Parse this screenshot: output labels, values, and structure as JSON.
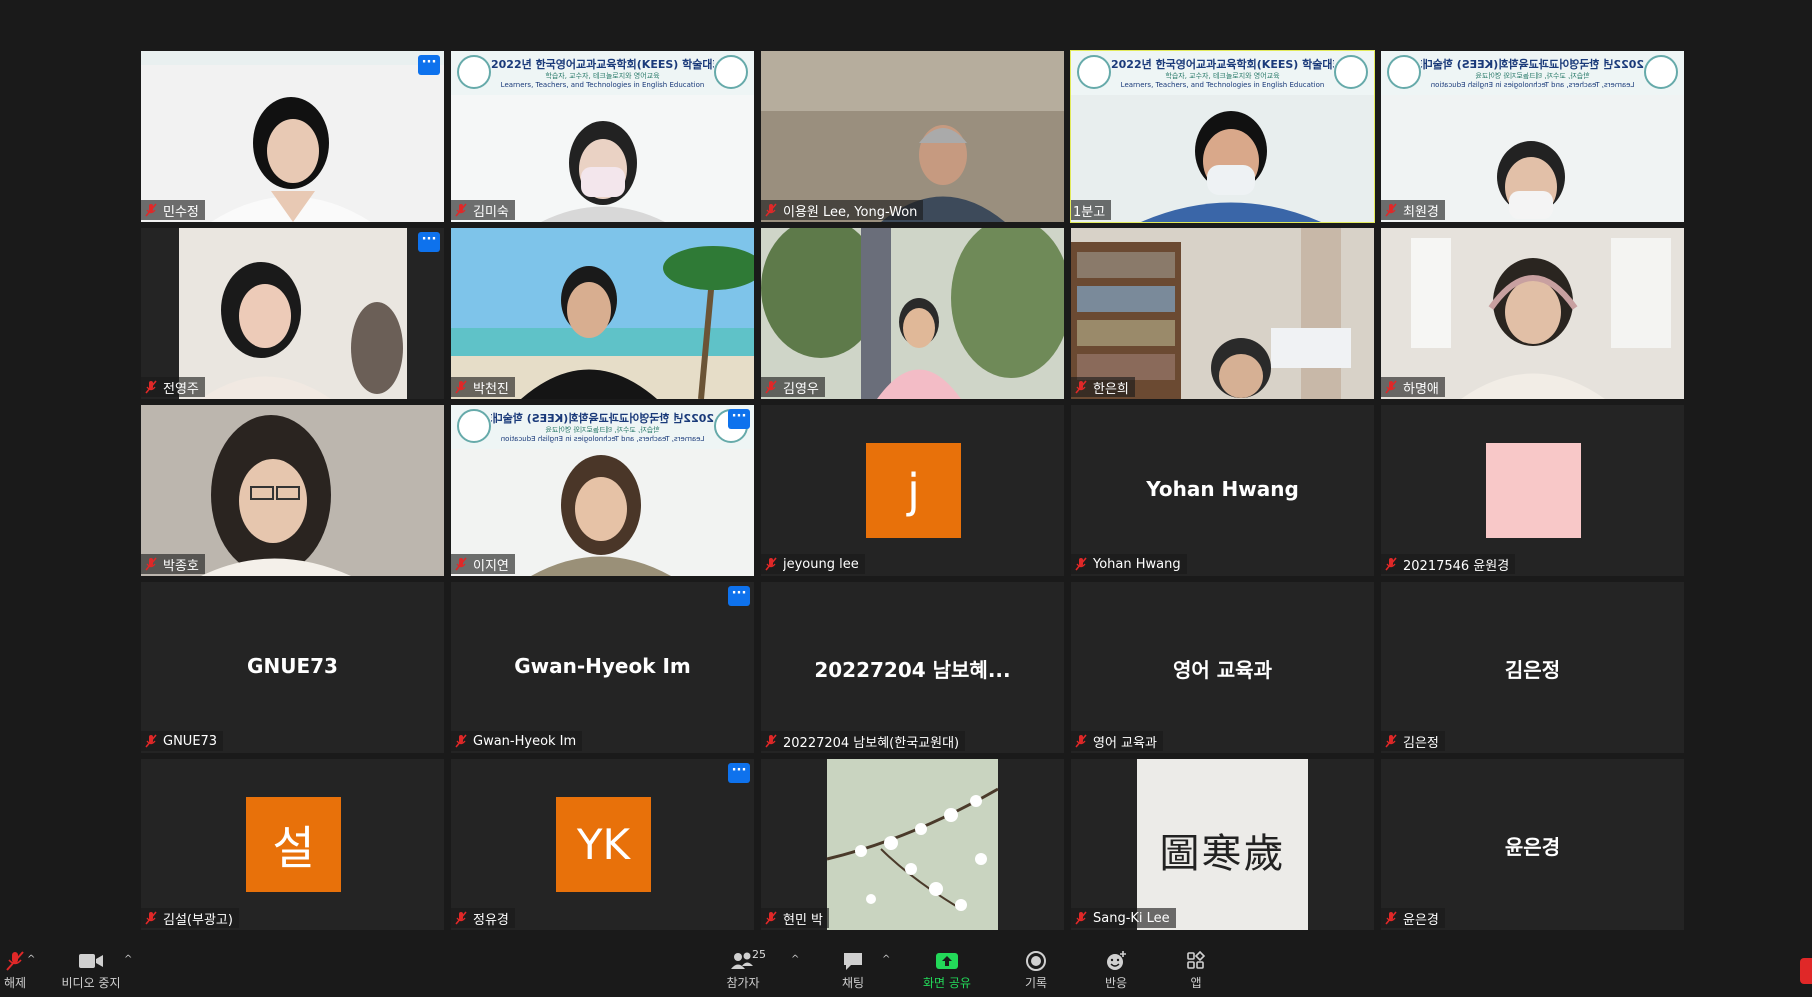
{
  "conference_banner": {
    "line1": "2022년 한국영어교과교육학회(KEES) 학술대회",
    "line2": "학습자, 교수자, 테크놀로지와 영어교육",
    "line3": "Learners, Teachers, and Technologies in English Education"
  },
  "participants": [
    {
      "name": "민수정"
    },
    {
      "name": "김미숙"
    },
    {
      "name": "이용원 Lee,  Yong-Won"
    },
    {
      "name": "1분고"
    },
    {
      "name": "최원경"
    },
    {
      "name": "전영주"
    },
    {
      "name": "박천진"
    },
    {
      "name": "김영우"
    },
    {
      "name": "한은희"
    },
    {
      "name": "하명애"
    },
    {
      "name": "박종호"
    },
    {
      "name": "이지연"
    },
    {
      "name": "jeyoung lee",
      "avatar": "j"
    },
    {
      "name": "Yohan Hwang",
      "center": "Yohan Hwang"
    },
    {
      "name": "20217546 윤원경"
    },
    {
      "name": "GNUE73",
      "center": "GNUE73"
    },
    {
      "name": "Gwan-Hyeok Im",
      "center": "Gwan-Hyeok Im"
    },
    {
      "name": "20227204 남보혜(한국교원대)",
      "center": "20227204 남보혜..."
    },
    {
      "name": "영어 교육과",
      "center": "영어 교육과"
    },
    {
      "name": "김은정",
      "center": "김은정"
    },
    {
      "name": "김설(부광고)",
      "avatar": "설"
    },
    {
      "name": "정유경",
      "avatar": "YK"
    },
    {
      "name": "현민 박"
    },
    {
      "name": "Sang-Ki Lee",
      "calligraphy": "圖寒歲"
    },
    {
      "name": "윤은경",
      "center": "윤은경"
    }
  ],
  "toolbar": {
    "unmute_label": "해제",
    "video_label": "비디오 중지",
    "participants_label": "참가자",
    "participants_count": "25",
    "chat_label": "채팅",
    "share_label": "화면 공유",
    "record_label": "기록",
    "reactions_label": "반응",
    "apps_label": "앱"
  },
  "colors": {
    "background": "#1a1a1a",
    "tile": "#242424",
    "active_speaker": "#e2ea5a",
    "avatar_orange": "#e8710a",
    "share_green": "#23d959",
    "menu_blue": "#0e72ed",
    "mute_red": "#e02828"
  }
}
